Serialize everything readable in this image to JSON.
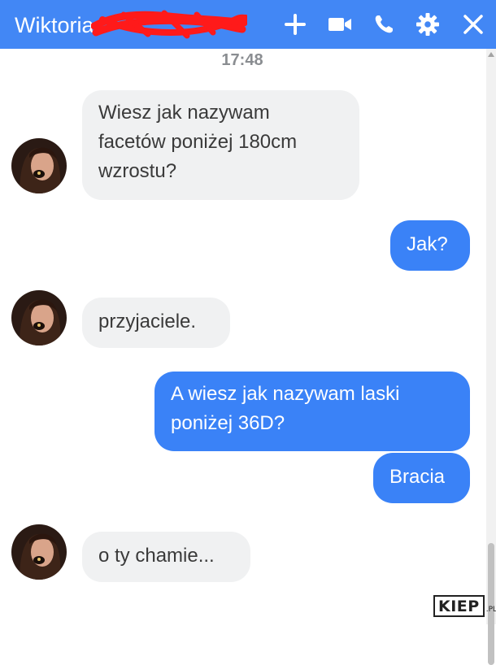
{
  "header": {
    "contact_name": "Wiktoria",
    "background_color": "#4287f5",
    "icons": [
      "plus-icon",
      "video-camera-icon",
      "phone-icon",
      "gear-icon",
      "close-icon"
    ]
  },
  "conversation": {
    "timestamp": "17:48",
    "messages": [
      {
        "sender": "contact",
        "lines": [
          "Wiesz jak nazywam",
          "facetów poniżej 180cm",
          "wzrostu?"
        ]
      },
      {
        "sender": "me",
        "text": "Jak?"
      },
      {
        "sender": "contact",
        "text": "przyjaciele."
      },
      {
        "sender": "me",
        "lines": [
          "A wiesz jak nazywam laski",
          "poniżej 36D?"
        ]
      },
      {
        "sender": "me",
        "text": "Bracia"
      },
      {
        "sender": "contact",
        "text": "o ty chamie..."
      }
    ]
  },
  "colors": {
    "incoming_bubble": "#f0f1f2",
    "outgoing_bubble": "#3a82f7",
    "timestamp_text": "#8a8d91"
  },
  "watermark": {
    "brand": "KIEP",
    "suffix": ".PL"
  }
}
